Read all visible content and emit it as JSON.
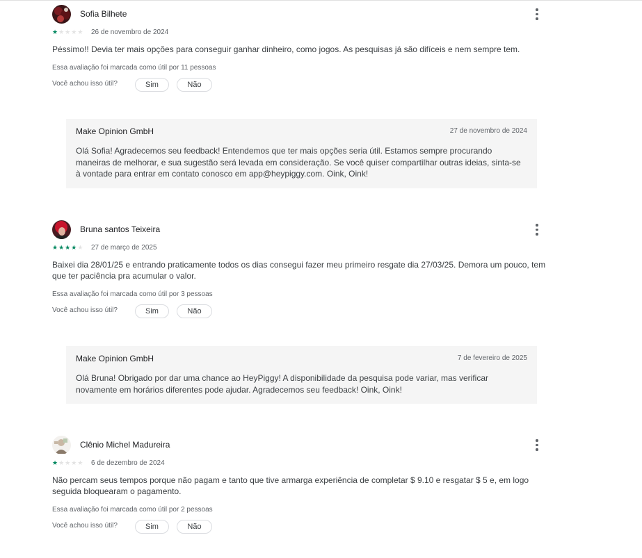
{
  "reviews": [
    {
      "author": "Sofia Bilhete",
      "rating": 1,
      "date": "26 de novembro de 2024",
      "text": "Péssimo!! Devia ter mais opções para conseguir ganhar dinheiro, como jogos. As pesquisas já são difíceis e nem sempre tem.",
      "helpful_count": "Essa avaliação foi marcada como útil por 11 pessoas",
      "helpful_question": "Você achou isso útil?",
      "yes_label": "Sim",
      "no_label": "Não",
      "reply": {
        "developer": "Make Opinion GmbH",
        "date": "27 de novembro de 2024",
        "text": "Olá Sofia! Agradecemos seu feedback! Entendemos que ter mais opções seria útil. Estamos sempre procurando maneiras de melhorar, e sua sugestão será levada em consideração. Se você quiser compartilhar outras ideias, sinta-se à vontade para entrar em contato conosco em app@heypiggy.com. Oink, Oink!"
      }
    },
    {
      "author": "Bruna santos Teixeira",
      "rating": 4,
      "date": "27 de março de 2025",
      "text": "Baixei dia 28/01/25 e entrando praticamente todos os dias consegui fazer meu primeiro resgate dia 27/03/25. Demora um pouco, tem que ter paciência pra acumular o valor.",
      "helpful_count": "Essa avaliação foi marcada como útil por 3 pessoas",
      "helpful_question": "Você achou isso útil?",
      "yes_label": "Sim",
      "no_label": "Não",
      "reply": {
        "developer": "Make Opinion GmbH",
        "date": "7 de fevereiro de 2025",
        "text": "Olá Bruna! Obrigado por dar uma chance ao HeyPiggy! A disponibilidade da pesquisa pode variar, mas verificar novamente em horários diferentes pode ajudar. Agradecemos seu feedback! Oink, Oink!"
      }
    },
    {
      "author": "Clênio Michel Madureira",
      "rating": 1,
      "date": "6 de dezembro de 2024",
      "text": "Não percam seus tempos porque não pagam e tanto que tive armarga experiência de completar $ 9.10 e resgatar $ 5 e, em logo seguida bloquearam o pagamento.",
      "helpful_count": "Essa avaliação foi marcada como útil por 2 pessoas",
      "helpful_question": "Você achou isso útil?",
      "yes_label": "Sim",
      "no_label": "Não"
    }
  ],
  "icons": {
    "star": "star-icon",
    "more": "more-vert-icon",
    "avatar": "avatar"
  },
  "colors": {
    "star_filled": "#01875f",
    "star_empty": "#e3e3e3",
    "reply_bg": "#f5f5f5"
  }
}
